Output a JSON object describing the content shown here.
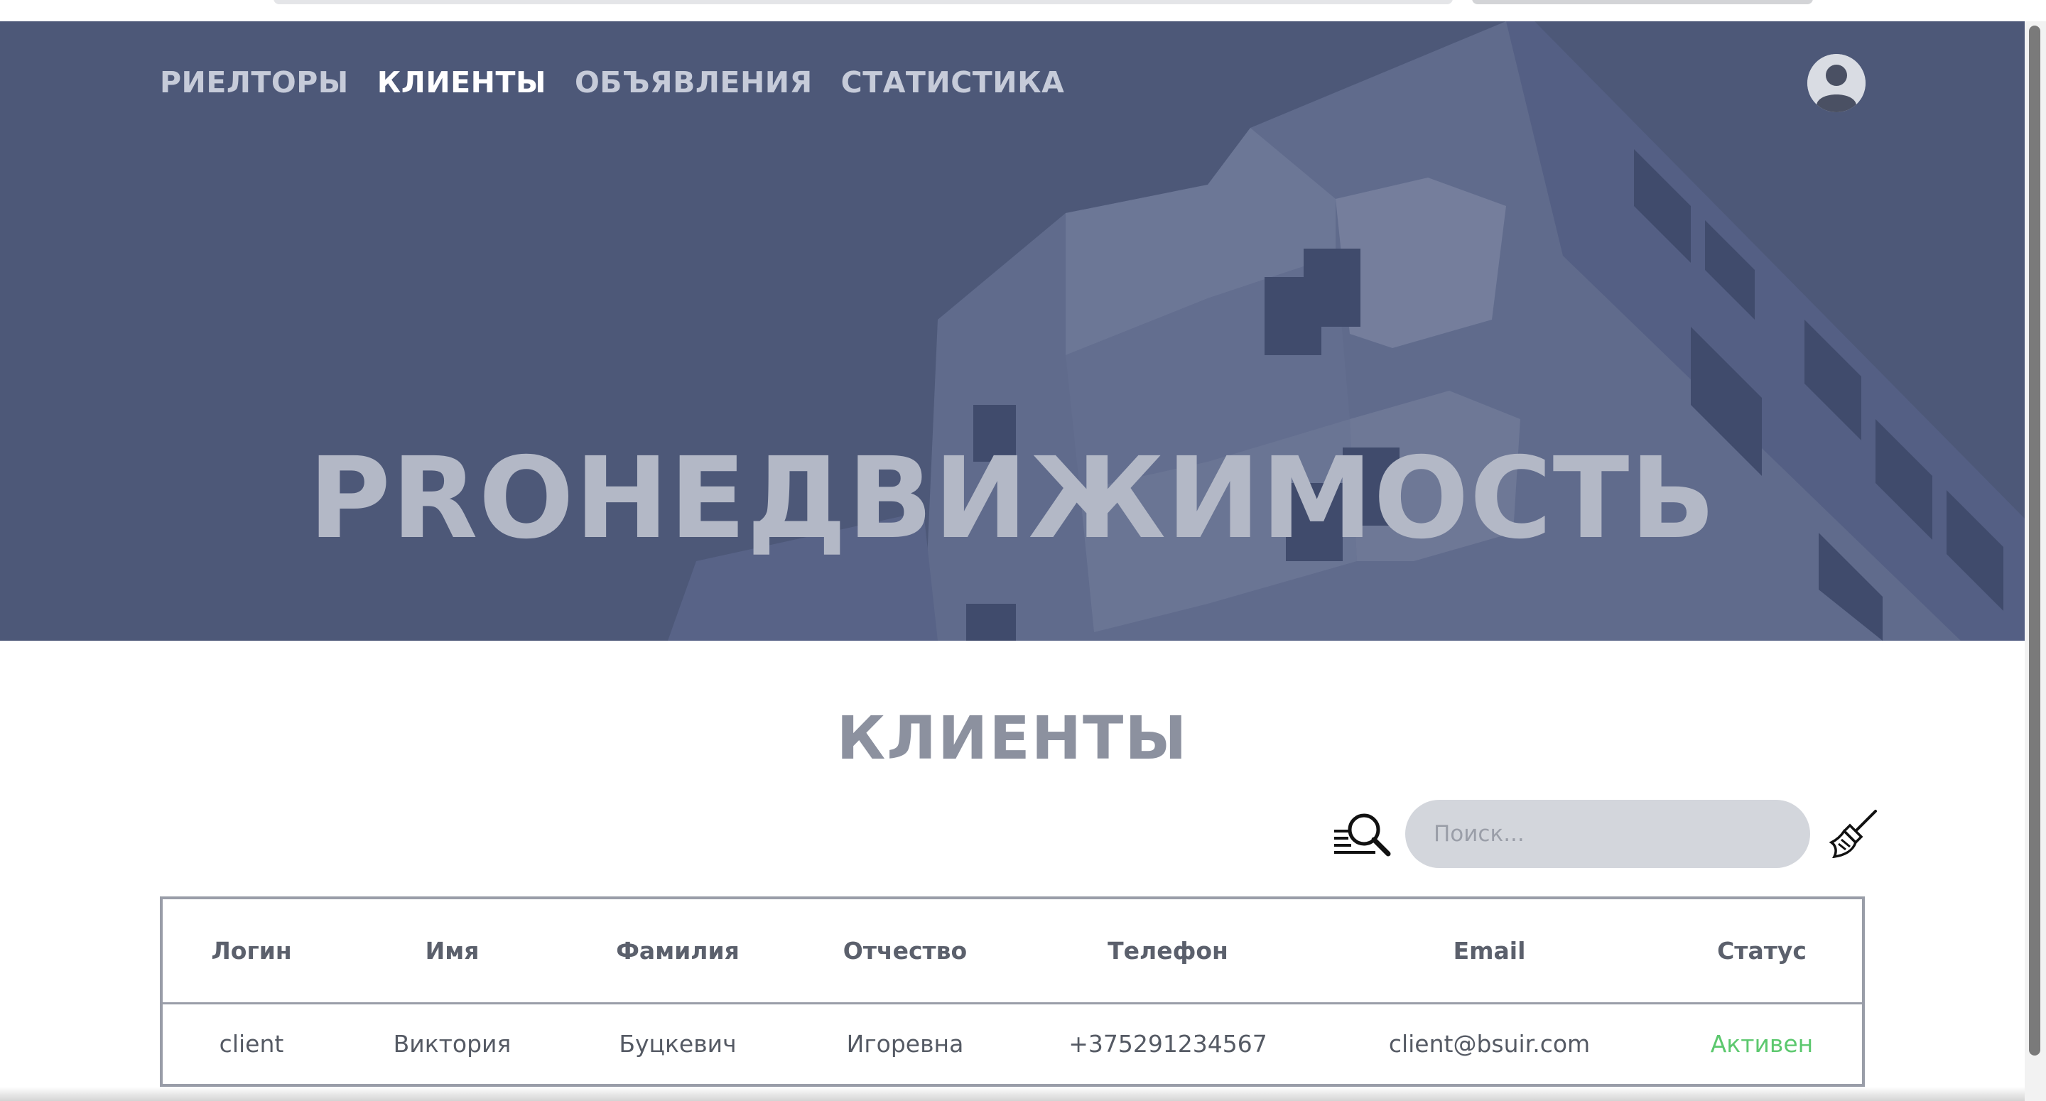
{
  "nav": {
    "items": [
      {
        "label": "РИЕЛТОРЫ",
        "active": false
      },
      {
        "label": "КЛИЕНТЫ",
        "active": true
      },
      {
        "label": "ОБЪЯВЛЕНИЯ",
        "active": false
      },
      {
        "label": "СТАТИСТИКА",
        "active": false
      }
    ]
  },
  "hero": {
    "brand": "PROНЕДВИЖИМОСТЬ"
  },
  "page": {
    "title": "КЛИЕНТЫ"
  },
  "search": {
    "placeholder": "Поиск...",
    "value": ""
  },
  "table": {
    "columns": [
      "Логин",
      "Имя",
      "Фамилия",
      "Отчество",
      "Телефон",
      "Email",
      "Статус"
    ],
    "rows": [
      [
        "client",
        "Виктория",
        "Буцкевич",
        "Игоревна",
        "+375291234567",
        "client@bsuir.com",
        "Активен"
      ]
    ]
  },
  "icons": {
    "avatar": "user-avatar-icon",
    "search": "search-speed-icon",
    "clear": "broom-icon"
  },
  "colors": {
    "hero_overlay": "#4d5879",
    "nav_active": "#ffffff",
    "nav_inactive": "#c6cbd9",
    "status_active": "#5cc86e",
    "table_border": "#999da8"
  }
}
